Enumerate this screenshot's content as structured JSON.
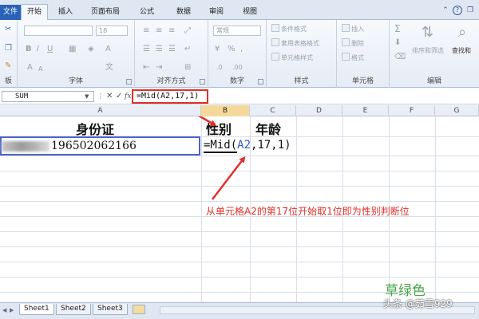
{
  "tabs": [
    {
      "label": "文件"
    },
    {
      "label": "开始"
    },
    {
      "label": "插入"
    },
    {
      "label": "页面布局"
    },
    {
      "label": "公式"
    },
    {
      "label": "数据"
    },
    {
      "label": "审阅"
    },
    {
      "label": "视图"
    }
  ],
  "ribbon": {
    "font_size": "18",
    "number_format": "常规",
    "styles": {
      "conditional_format": "条件格式",
      "table_format": "套用表格格式",
      "cell_styles": "单元格样式"
    },
    "cells": {
      "insert": "插入",
      "delete": "删除",
      "format": "格式"
    },
    "editing": {
      "sort_filter": "排序和筛选",
      "find_select": "查找和"
    },
    "group_labels": {
      "clipboard": "板",
      "font": "字体",
      "alignment": "对齐方式",
      "number": "数字",
      "styles": "样式",
      "cells": "单元格",
      "editing": "编辑"
    }
  },
  "formula_bar": {
    "name_box": "SUM",
    "cancel_symbol": "✕",
    "enter_symbol": "✓",
    "fx": "fx",
    "formula": "=Mid(A2,17,1)"
  },
  "columns": [
    "A",
    "B",
    "C",
    "D",
    "E",
    "F",
    "G"
  ],
  "cells": {
    "A1": "身份证",
    "B1": "性别",
    "C1": "年龄",
    "A2": "196502062166",
    "B2_prefix": "=Mid(",
    "B2_ref": "A2",
    "B2_suffix": ",17,1)"
  },
  "annotation": "从单元格A2的第17位开始取1位即为性别判断位",
  "watermark": {
    "title": "草绿色",
    "user": "头条 @茹雪929"
  },
  "sheet_tabs": [
    "Sheet1",
    "Sheet2",
    "Sheet3"
  ],
  "colors": {
    "highlight_red": "#e0302a",
    "cell_ref_blue": "#2f58c8",
    "watermark_green": "#4aa64a"
  }
}
